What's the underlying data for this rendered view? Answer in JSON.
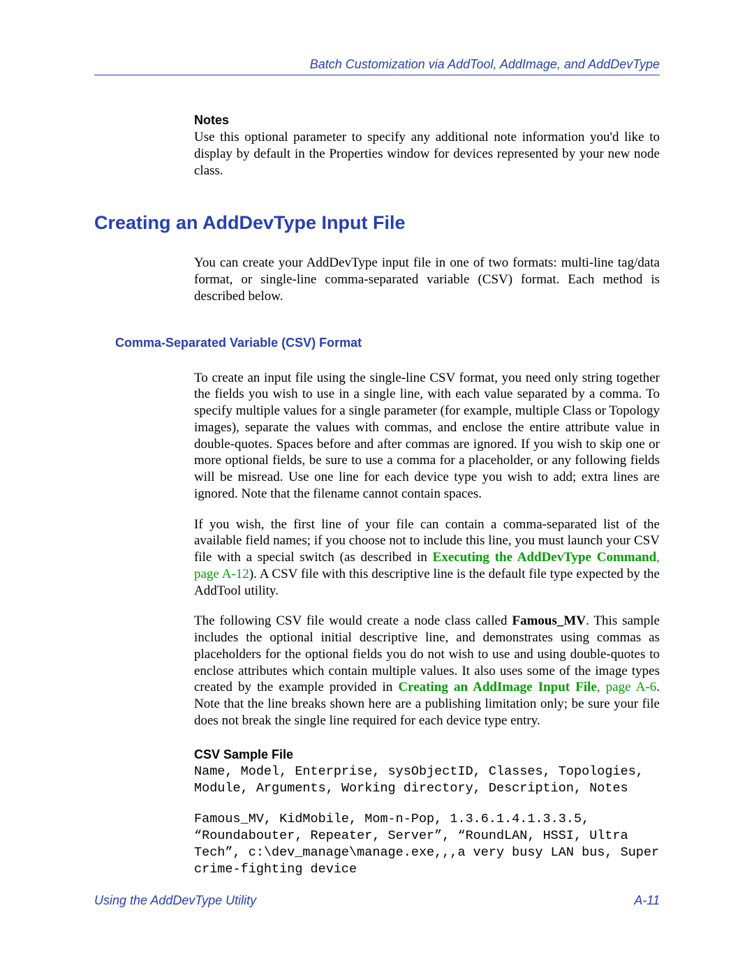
{
  "header": {
    "running_title": "Batch Customization via AddTool, AddImage, and AddDevType"
  },
  "notes": {
    "heading": "Notes",
    "body": "Use this optional parameter to specify any additional note information you'd like to display by default in the Properties window for devices represented by your new node class."
  },
  "h1": "Creating an AddDevType Input File",
  "intro": "You can create your AddDevType input file in one of two formats: multi-line tag/data format, or single-line comma-separated variable (CSV) format. Each method is described below.",
  "h2": "Comma-Separated Variable (CSV) Format",
  "csv": {
    "p1": "To create an input file using the single-line CSV format, you need only string together the fields you wish to use in a single line, with each value separated by a comma. To specify multiple values for a single parameter (for example, multiple Class or Topology images), separate the values with commas, and enclose the entire attribute value in double-quotes. Spaces before and after commas are ignored. If you wish to skip one or more optional fields, be sure to use a comma for a placeholder, or any following fields will be misread. Use one line for each device type you wish to add; extra lines are ignored. Note that the filename cannot contain spaces.",
    "p2a": "If you wish, the first line of your file can contain a comma-separated list of the available field names; if you choose not to include this line, you must launch your CSV file with a special switch (as described in ",
    "p2_link_label": "Executing the AddDevType Command",
    "p2_link_page": ", page A-12",
    "p2b": "). A CSV file with this descriptive line is the default file type expected by the AddTool utility.",
    "p3a": "The following CSV file would create a node class called ",
    "p3_bold": "Famous_MV",
    "p3b": ". This sample includes the optional initial descriptive line, and demonstrates using commas as placeholders for the optional fields you do not wish to use and using double-quotes to enclose attributes which contain multiple values. It also uses some of the image types created by the example provided in ",
    "p3_link_label": "Creating an AddImage Input File",
    "p3_link_page": ", page A-6",
    "p3c": ". Note that the line breaks shown here are a publishing limitation only; be sure your file does not break the single line required for each device type entry.",
    "sample_heading": "CSV Sample File",
    "sample_line1": "Name, Model, Enterprise, sysObjectID, Classes, Topologies, Module, Arguments, Working directory, Description, Notes",
    "sample_line2": "Famous_MV, KidMobile, Mom-n-Pop, 1.3.6.1.4.1.3.3.5, “Roundabouter, Repeater, Server”, “RoundLAN, HSSI, Ultra Tech”, c:\\dev_manage\\manage.exe,,,a very busy LAN bus, Super crime-fighting device"
  },
  "footer": {
    "left": "Using the AddDevType Utility",
    "right": "A-11"
  }
}
